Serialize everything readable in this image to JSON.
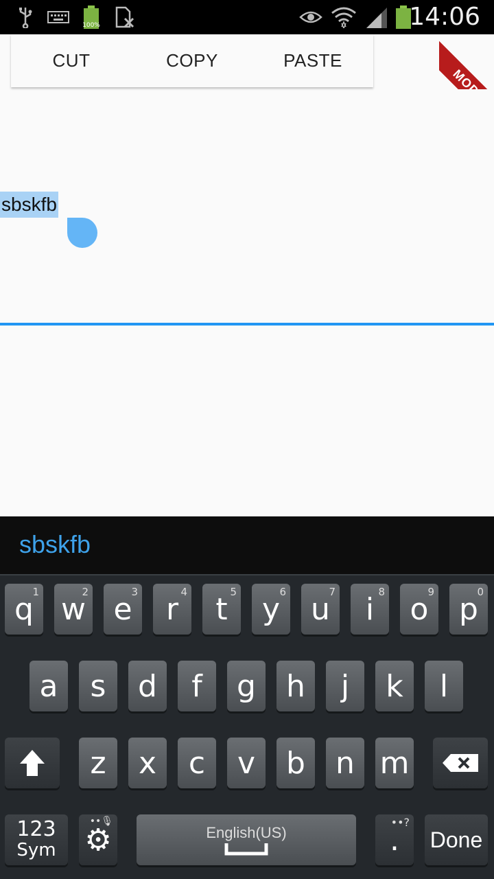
{
  "status_bar": {
    "time": "14:06",
    "battery_percent_label": "100%",
    "icons": [
      "usb-icon",
      "keyboard-icon",
      "battery-icon",
      "sim-icon",
      "eye-icon",
      "wifi-icon",
      "signal-icon",
      "battery-full-icon"
    ]
  },
  "ribbon": {
    "label": "MODE"
  },
  "text_toolbar": {
    "cut": "CUT",
    "copy": "COPY",
    "paste": "PASTE"
  },
  "text_field": {
    "value": "sbskfb"
  },
  "keyboard": {
    "suggestion": "sbskfb",
    "row1": [
      {
        "letter": "q",
        "num": "1"
      },
      {
        "letter": "w",
        "num": "2"
      },
      {
        "letter": "e",
        "num": "3"
      },
      {
        "letter": "r",
        "num": "4"
      },
      {
        "letter": "t",
        "num": "5"
      },
      {
        "letter": "y",
        "num": "6"
      },
      {
        "letter": "u",
        "num": "7"
      },
      {
        "letter": "i",
        "num": "8"
      },
      {
        "letter": "o",
        "num": "9"
      },
      {
        "letter": "p",
        "num": "0"
      }
    ],
    "row2": [
      "a",
      "s",
      "d",
      "f",
      "g",
      "h",
      "j",
      "k",
      "l"
    ],
    "row3": [
      "z",
      "x",
      "c",
      "v",
      "b",
      "n",
      "m"
    ],
    "sym_top": "123",
    "sym_bottom": "Sym",
    "space_label": "English(US)",
    "period": ".",
    "done": "Done"
  },
  "colors": {
    "accent": "#2196f3",
    "selection": "#a9d2f5",
    "handle": "#64b5f6",
    "suggestion": "#3ea2ea"
  }
}
